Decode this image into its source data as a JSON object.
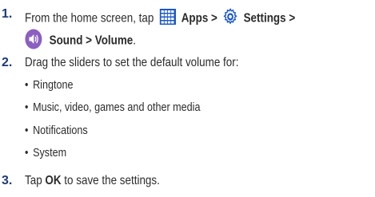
{
  "step1": {
    "number": "1.",
    "text_before": "From the home screen, tap",
    "apps_label": "Apps >",
    "settings_label": "Settings >",
    "sound_label": "Sound > Volume",
    "end_period": ".",
    "icons": [
      "apps-grid-icon",
      "settings-gear-icon",
      "sound-speaker-icon"
    ],
    "colors": {
      "apps": "#1a57c9",
      "settings": "#1a57c9",
      "sound": "#8b5fc0"
    }
  },
  "step2": {
    "number": "2.",
    "text": "Drag the sliders to set the default volume for:",
    "bullets": [
      "Ringtone",
      "Music, video, games and other media",
      "Notifications",
      "System"
    ]
  },
  "step3": {
    "number": "3.",
    "text_before": "Tap",
    "bold": "OK",
    "text_after": "to save the settings."
  },
  "colors": {
    "number": "#1d3a73",
    "text": "#2b2b2b"
  }
}
